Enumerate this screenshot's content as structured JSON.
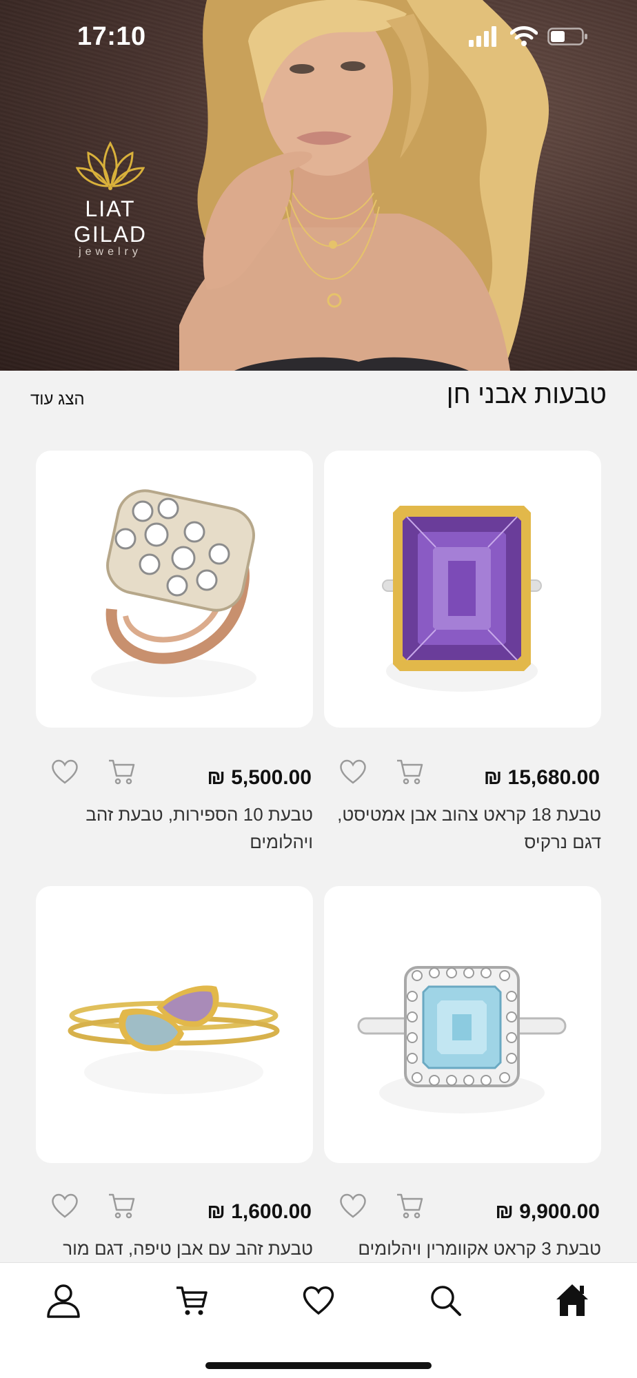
{
  "status_bar": {
    "time": "17:10"
  },
  "brand": {
    "name": "LIAT GILAD",
    "tagline": "jewelry",
    "logo_color": "#d9b13b"
  },
  "section": {
    "title": "טבעות אבני חן",
    "show_more": "הצג עוד"
  },
  "products": [
    {
      "price": "₪ 15,680.00",
      "name": "טבעת 18 קראט צהוב אבן אמטיסט, דגם נרקיס",
      "image": "amethyst-gold-ring"
    },
    {
      "price": "₪ 5,500.00",
      "name": "טבעת 10 הספירות, טבעת זהב ויהלומים",
      "image": "diamond-cluster-rose-gold-ring"
    },
    {
      "price": "₪ 9,900.00",
      "name": "טבעת 3 קראט אקוומרין ויהלומים",
      "image": "aquamarine-halo-ring"
    },
    {
      "price": "₪ 1,600.00",
      "name": "טבעת זהב עם אבן טיפה, דגם מור",
      "image": "double-pear-stone-gold-ring"
    }
  ],
  "bottom_nav": [
    {
      "name": "profile",
      "icon": "user-icon"
    },
    {
      "name": "cart",
      "icon": "cart-icon"
    },
    {
      "name": "favorites",
      "icon": "heart-icon"
    },
    {
      "name": "search",
      "icon": "search-icon"
    },
    {
      "name": "home",
      "icon": "home-icon"
    }
  ],
  "colors": {
    "background": "#f2f2f2",
    "card": "#ffffff",
    "text": "#111111",
    "icon_muted": "#9a9a9a"
  }
}
